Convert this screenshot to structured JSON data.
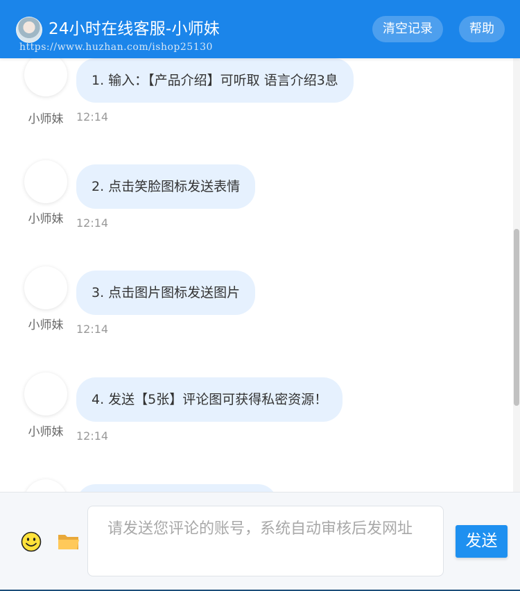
{
  "header": {
    "title": "24小时在线客服-小师妹",
    "watermark": "https://www.huzhan.com/ishop25130",
    "clear_label": "清空记录",
    "help_label": "帮助",
    "bg_color": "#1b85ea"
  },
  "messages": [
    {
      "sender": "小师妹",
      "text": "1. 输入：【产品介绍】可听取 语言介绍3息",
      "time": "12:14"
    },
    {
      "sender": "小师妹",
      "text": "2. 点击笑脸图标发送表情",
      "time": "12:14"
    },
    {
      "sender": "小师妹",
      "text": "3. 点击图片图标发送图片",
      "time": "12:14"
    },
    {
      "sender": "小师妹",
      "text": "4. 发送【5张】评论图可获得私密资源！",
      "time": "12:14"
    }
  ],
  "input": {
    "placeholder": "请发送您评论的账号，系统自动审核后发网址",
    "emoji_icon": "smiley-icon",
    "image_icon": "folder-icon",
    "send_label": "发送"
  }
}
